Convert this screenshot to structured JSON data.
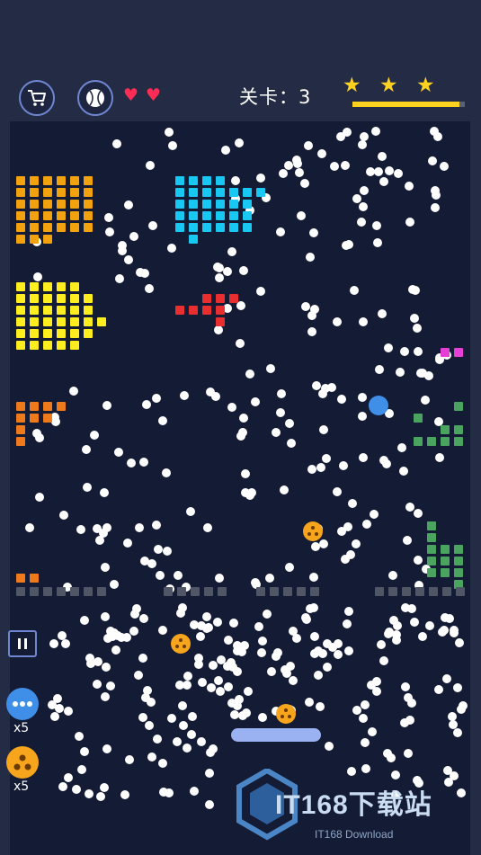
{
  "hud": {
    "level_label": "关卡：3",
    "lives": 2,
    "stars_earned": 3,
    "progress_fraction": 0.95
  },
  "icons": {
    "shop": "cart-icon",
    "ball": "baseball-icon",
    "life": "heart-icon",
    "star": "star-icon",
    "pause": "pause-icon"
  },
  "powerups": {
    "multi_ball_count": "x5",
    "split_ball_count": "x5"
  },
  "colors": {
    "background": "#232b45",
    "field": "#141b34",
    "star": "#ffd21f",
    "heart": "#ff2d55",
    "paddle": "#9ab1f2",
    "bricks": {
      "orange": "#f2a20e",
      "cyan": "#19c8f2",
      "yellow": "#ffee1f",
      "red": "#e82e2e",
      "orange_dark": "#ef7a1b",
      "green": "#4aa35f",
      "magenta": "#e63fd6",
      "gray": "#505666"
    }
  },
  "watermark": {
    "title": "IT168下载站",
    "subtitle": "IT168 Download"
  }
}
